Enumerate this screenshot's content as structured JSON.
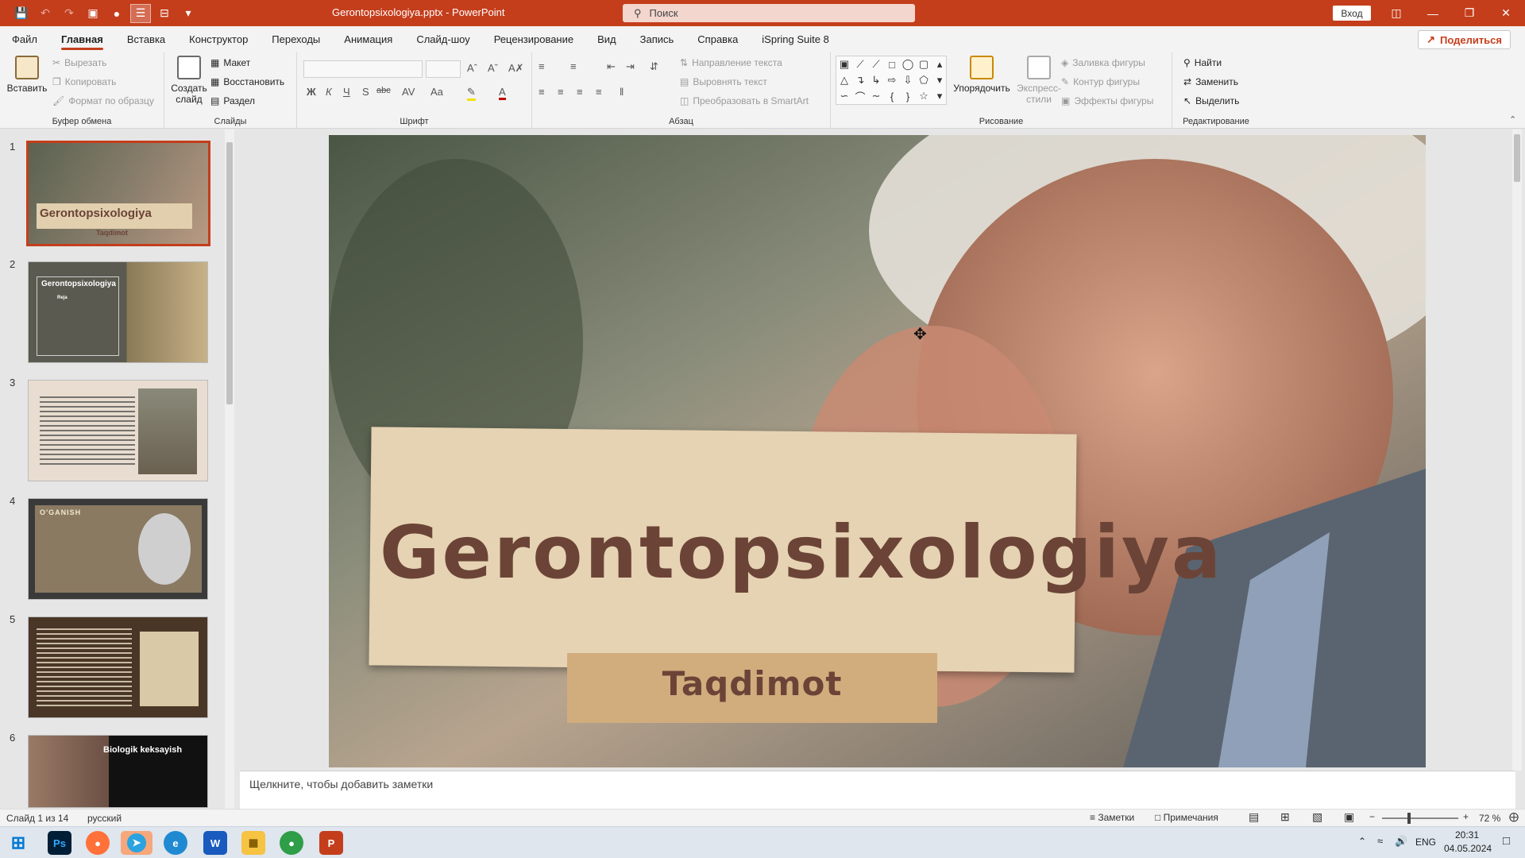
{
  "window": {
    "doc_title": "Gerontopsixologiya.pptx  -  PowerPoint",
    "search_placeholder": "Поиск",
    "signin": "Вход"
  },
  "menu": {
    "tabs": [
      "Файл",
      "Главная",
      "Вставка",
      "Конструктор",
      "Переходы",
      "Анимация",
      "Слайд-шоу",
      "Рецензирование",
      "Вид",
      "Запись",
      "Справка",
      "iSpring Suite 8"
    ],
    "share": "Поделиться"
  },
  "ribbon": {
    "clipboard": {
      "paste": "Вставить",
      "cut": "Вырезать",
      "copy": "Копировать",
      "format_painter": "Формат по образцу",
      "label": "Буфер обмена"
    },
    "slides": {
      "new_slide_1": "Создать",
      "new_slide_2": "слайд",
      "layout": "Макет",
      "reset": "Восстановить",
      "section": "Раздел",
      "label": "Слайды"
    },
    "font": {
      "bold": "Ж",
      "italic": "К",
      "underline": "Ч",
      "strike": "S",
      "abc": "abc",
      "aa": "Aa",
      "label": "Шрифт"
    },
    "paragraph": {
      "text_direction": "Направление текста",
      "align_text": "Выровнять текст",
      "smartart": "Преобразовать в SmartArt",
      "label": "Абзац"
    },
    "drawing": {
      "arrange": "Упорядочить",
      "quick_styles_1": "Экспресс-",
      "quick_styles_2": "стили",
      "fill": "Заливка фигуры",
      "outline": "Контур фигуры",
      "effects": "Эффекты фигуры",
      "label": "Рисование"
    },
    "editing": {
      "find": "Найти",
      "replace": "Заменить",
      "select": "Выделить",
      "label": "Редактирование"
    }
  },
  "thumbnails": [
    {
      "num": "1",
      "title": "Gerontopsixologiya",
      "sub": "Taqdimot"
    },
    {
      "num": "2",
      "title": "Gerontopsixologiya",
      "sub": "Reja"
    },
    {
      "num": "3",
      "title": "",
      "sub": ""
    },
    {
      "num": "4",
      "title": "O'GANISH",
      "sub": ""
    },
    {
      "num": "5",
      "title": "",
      "sub": ""
    },
    {
      "num": "6",
      "title": "Biologik keksayish",
      "sub": ""
    }
  ],
  "slide": {
    "title": "Gerontopsixologiya",
    "subtitle": "Taqdimot"
  },
  "notes_placeholder": "Щелкните, чтобы добавить заметки",
  "status": {
    "slide_count": "Слайд 1 из 14",
    "language": "русский",
    "notes": "Заметки",
    "comments": "Примечания",
    "zoom": "72 %"
  },
  "taskbar": {
    "lang": "ENG",
    "time": "20:31",
    "date": "04.05.2024"
  },
  "colors": {
    "accent": "#c43e1c",
    "slide_title": "#6b4437",
    "paper": "#e6d3b3"
  }
}
